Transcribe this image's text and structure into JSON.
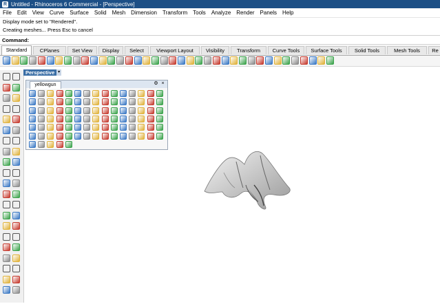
{
  "window": {
    "title": "Untitled - Rhinoceros 6 Commercial - [Perspective]"
  },
  "menu": [
    "File",
    "Edit",
    "View",
    "Curve",
    "Surface",
    "Solid",
    "Mesh",
    "Dimension",
    "Transform",
    "Tools",
    "Analyze",
    "Render",
    "Panels",
    "Help"
  ],
  "history": [
    "Display mode set to \"Rendered\".",
    "Creating meshes... Press Esc to cancel"
  ],
  "command": {
    "label": "Command:",
    "value": ""
  },
  "tabs": [
    "Standard",
    "CPlanes",
    "Set View",
    "Display",
    "Select",
    "Viewport Layout",
    "Visibility",
    "Transform",
    "Curve Tools",
    "Surface Tools",
    "Solid Tools",
    "Mesh Tools",
    "Re"
  ],
  "viewport": {
    "name": "Perspective",
    "dropdown": "▾"
  },
  "palette": {
    "tab": "yellowgun",
    "settings": "⚙",
    "close": "×"
  },
  "colors": {
    "titlebar": "#1c4f86",
    "viewport_label": "#3a6ea5",
    "icon_blue": "#3a78c4",
    "icon_gray": "#8a8a8a",
    "icon_yellow": "#e0b23a",
    "icon_red": "#c63a2e",
    "icon_green": "#3aa24a"
  }
}
